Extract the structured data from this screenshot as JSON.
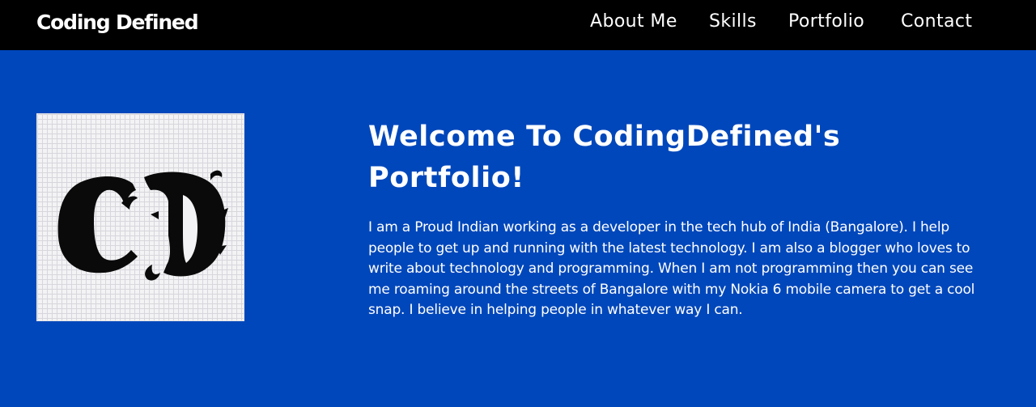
{
  "header": {
    "brand": "Coding Defined",
    "nav": [
      {
        "label": "About Me"
      },
      {
        "label": "Skills"
      },
      {
        "label": "Portfolio"
      },
      {
        "label": "Contact"
      }
    ]
  },
  "hero": {
    "logo_text": "CD",
    "title": "Welcome To CodingDefined's Portfolio!",
    "description": "I am a Proud Indian working as a developer in the tech hub of India (Bangalore). I help people to get up and running with the latest technology. I am also a blogger who loves to write about technology and programming. When I am not programming then you can see me roaming around the streets of Bangalore with my Nokia 6 mobile camera to get a cool snap. I believe in helping people in whatever way I can."
  },
  "colors": {
    "navbar_bg": "#000000",
    "hero_bg": "#0047BB",
    "text": "#ffffff"
  }
}
